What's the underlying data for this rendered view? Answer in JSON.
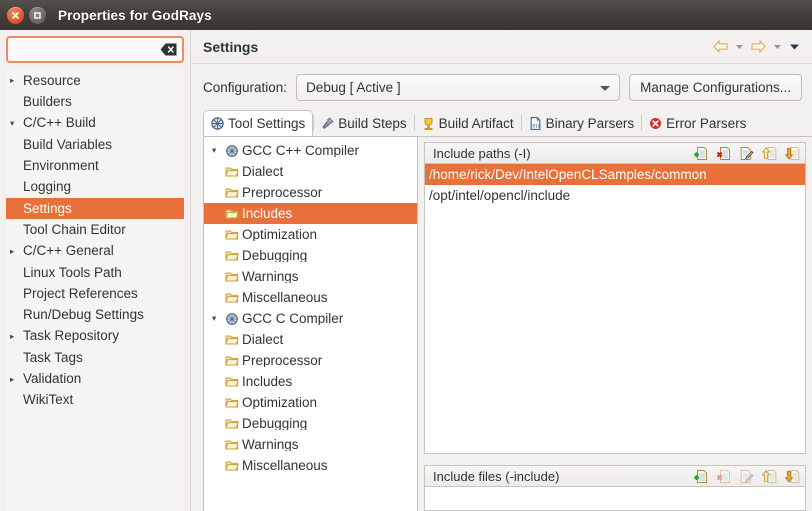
{
  "window": {
    "title": "Properties for GodRays",
    "close_label": "Close",
    "maximize_label": "Maximize"
  },
  "colors": {
    "selection": "#e8703a",
    "list_selection": "#ef8050",
    "titlebar": "#413c38",
    "focus_border": "#f08a5f"
  },
  "filter": {
    "value": "",
    "placeholder": "",
    "clear_label": "Clear"
  },
  "sidebar": {
    "items": [
      {
        "label": "Resource",
        "arrow": "▸",
        "indent": false,
        "selected": false
      },
      {
        "label": "Builders",
        "arrow": "",
        "indent": false,
        "selected": false
      },
      {
        "label": "C/C++ Build",
        "arrow": "▾",
        "indent": false,
        "selected": false
      },
      {
        "label": "Build Variables",
        "arrow": "",
        "indent": true,
        "selected": false
      },
      {
        "label": "Environment",
        "arrow": "",
        "indent": true,
        "selected": false
      },
      {
        "label": "Logging",
        "arrow": "",
        "indent": true,
        "selected": false
      },
      {
        "label": "Settings",
        "arrow": "",
        "indent": true,
        "selected": true
      },
      {
        "label": "Tool Chain Editor",
        "arrow": "",
        "indent": true,
        "selected": false
      },
      {
        "label": "C/C++ General",
        "arrow": "▸",
        "indent": false,
        "selected": false
      },
      {
        "label": "Linux Tools Path",
        "arrow": "",
        "indent": false,
        "selected": false
      },
      {
        "label": "Project References",
        "arrow": "",
        "indent": false,
        "selected": false
      },
      {
        "label": "Run/Debug Settings",
        "arrow": "",
        "indent": false,
        "selected": false
      },
      {
        "label": "Task Repository",
        "arrow": "▸",
        "indent": false,
        "selected": false
      },
      {
        "label": "Task Tags",
        "arrow": "",
        "indent": false,
        "selected": false
      },
      {
        "label": "Validation",
        "arrow": "▸",
        "indent": false,
        "selected": false
      },
      {
        "label": "WikiText",
        "arrow": "",
        "indent": false,
        "selected": false
      }
    ]
  },
  "header": {
    "title": "Settings",
    "back_label": "Back",
    "back_menu_label": "Back history",
    "forward_label": "Forward",
    "forward_menu_label": "Forward history",
    "menu_label": "View menu"
  },
  "configuration": {
    "label": "Configuration:",
    "selected": "Debug  [ Active ]",
    "manage_button": "Manage Configurations..."
  },
  "tabs": [
    {
      "label": "Tool Settings",
      "icon": "tool-settings-icon",
      "active": true
    },
    {
      "label": "Build Steps",
      "icon": "build-steps-icon",
      "active": false
    },
    {
      "label": "Build Artifact",
      "icon": "build-artifact-icon",
      "active": false
    },
    {
      "label": "Binary Parsers",
      "icon": "binary-parsers-icon",
      "active": false
    },
    {
      "label": "Error Parsers",
      "icon": "error-parsers-icon",
      "active": false
    }
  ],
  "tool_tree": [
    {
      "label": "GCC C++ Compiler",
      "arrow": "▾",
      "icon": "compiler-icon",
      "child": false,
      "selected": false
    },
    {
      "label": "Dialect",
      "arrow": "",
      "icon": "folder-icon",
      "child": true,
      "selected": false
    },
    {
      "label": "Preprocessor",
      "arrow": "",
      "icon": "folder-icon",
      "child": true,
      "selected": false
    },
    {
      "label": "Includes",
      "arrow": "",
      "icon": "folder-icon",
      "child": true,
      "selected": true
    },
    {
      "label": "Optimization",
      "arrow": "",
      "icon": "folder-icon",
      "child": true,
      "selected": false
    },
    {
      "label": "Debugging",
      "arrow": "",
      "icon": "folder-icon",
      "child": true,
      "selected": false
    },
    {
      "label": "Warnings",
      "arrow": "",
      "icon": "folder-icon",
      "child": true,
      "selected": false
    },
    {
      "label": "Miscellaneous",
      "arrow": "",
      "icon": "folder-icon",
      "child": true,
      "selected": false
    },
    {
      "label": "GCC C Compiler",
      "arrow": "▾",
      "icon": "compiler-icon",
      "child": false,
      "selected": false
    },
    {
      "label": "Dialect",
      "arrow": "",
      "icon": "folder-icon",
      "child": true,
      "selected": false
    },
    {
      "label": "Preprocessor",
      "arrow": "",
      "icon": "folder-icon",
      "child": true,
      "selected": false
    },
    {
      "label": "Includes",
      "arrow": "",
      "icon": "folder-icon",
      "child": true,
      "selected": false
    },
    {
      "label": "Optimization",
      "arrow": "",
      "icon": "folder-icon",
      "child": true,
      "selected": false
    },
    {
      "label": "Debugging",
      "arrow": "",
      "icon": "folder-icon",
      "child": true,
      "selected": false
    },
    {
      "label": "Warnings",
      "arrow": "",
      "icon": "folder-icon",
      "child": true,
      "selected": false
    },
    {
      "label": "Miscellaneous",
      "arrow": "",
      "icon": "folder-icon",
      "child": true,
      "selected": false
    }
  ],
  "include_paths": {
    "title": "Include paths (-I)",
    "entries": [
      {
        "path": "/home/rick/Dev/IntelOpenCLSamples/common",
        "selected": true
      },
      {
        "path": "/opt/intel/opencl/include",
        "selected": false
      }
    ],
    "tools": [
      {
        "name": "add-icon",
        "label": "Add",
        "enabled": true
      },
      {
        "name": "delete-icon",
        "label": "Delete",
        "enabled": true
      },
      {
        "name": "edit-icon",
        "label": "Edit",
        "enabled": true
      },
      {
        "name": "move-up-icon",
        "label": "Move Up",
        "enabled": true
      },
      {
        "name": "move-down-icon",
        "label": "Move Down",
        "enabled": true
      }
    ]
  },
  "include_files": {
    "title": "Include files (-include)",
    "entries": [],
    "tools": [
      {
        "name": "add-icon",
        "label": "Add",
        "enabled": true
      },
      {
        "name": "delete-icon",
        "label": "Delete",
        "enabled": false
      },
      {
        "name": "edit-icon",
        "label": "Edit",
        "enabled": false
      },
      {
        "name": "move-up-icon",
        "label": "Move Up",
        "enabled": true
      },
      {
        "name": "move-down-icon",
        "label": "Move Down",
        "enabled": true
      }
    ]
  }
}
